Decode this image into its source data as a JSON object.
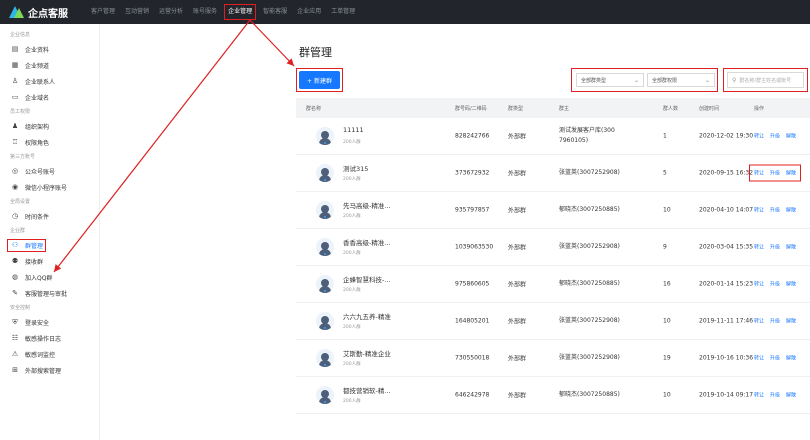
{
  "app": {
    "logo_text": "企点客服"
  },
  "topnav": [
    {
      "label": "客户管理",
      "active": false
    },
    {
      "label": "互动营销",
      "active": false
    },
    {
      "label": "运营分析",
      "active": false
    },
    {
      "label": "账号服务",
      "active": false
    },
    {
      "label": "企业管理",
      "active": true
    },
    {
      "label": "智能客服",
      "active": false
    },
    {
      "label": "企业应用",
      "active": false
    },
    {
      "label": "工单管理",
      "active": false
    }
  ],
  "sidebar": {
    "sections": [
      {
        "title": "企业信息",
        "items": [
          {
            "label": "企业资料",
            "icon": "document-icon"
          },
          {
            "label": "企业频道",
            "icon": "channel-icon"
          },
          {
            "label": "企业联系人",
            "icon": "contact-icon"
          },
          {
            "label": "企业域名",
            "icon": "domain-icon"
          }
        ]
      },
      {
        "title": "员工权限",
        "items": [
          {
            "label": "组织架构",
            "icon": "org-icon"
          },
          {
            "label": "权限角色",
            "icon": "role-icon"
          }
        ]
      },
      {
        "title": "第三方账号",
        "items": [
          {
            "label": "公众号账号",
            "icon": "official-account-icon"
          },
          {
            "label": "微信小程序账号",
            "icon": "mini-program-icon"
          }
        ]
      },
      {
        "title": "全局设置",
        "items": [
          {
            "label": "时间条件",
            "icon": "time-condition-icon"
          }
        ]
      },
      {
        "title": "企业群",
        "items": [
          {
            "label": "群管理",
            "icon": "group-manage-icon",
            "active": true
          },
          {
            "label": "接收群",
            "icon": "receive-group-icon"
          },
          {
            "label": "加入QQ群",
            "icon": "join-qq-group-icon"
          },
          {
            "label": "客服管理与审批",
            "icon": "approval-icon"
          }
        ]
      },
      {
        "title": "安全控制",
        "items": [
          {
            "label": "登录安全",
            "icon": "login-security-icon"
          },
          {
            "label": "敏感操作日志",
            "icon": "log-icon"
          },
          {
            "label": "敏感词监控",
            "icon": "warning-icon"
          },
          {
            "label": "外部搜索管理",
            "icon": "search-manage-icon"
          }
        ]
      }
    ]
  },
  "main": {
    "title": "群管理",
    "new_button": "+ 新建群",
    "filter_type": "全部群类型",
    "filter_scope": "全部群权限",
    "search_placeholder": "群名称/群主姓名或账号",
    "columns": [
      "群名称",
      "群号码/二维码",
      "群类型",
      "群主",
      "群人数",
      "创建时间",
      "操作"
    ],
    "rows": [
      {
        "name": "11111",
        "sub": "200人群",
        "id": "828242766",
        "type": "外部群",
        "owner": "测试发展客户库(300",
        "owner2": "7960105)",
        "count": "1",
        "time": "2020-12-02 19:30",
        "ops": [
          "转让",
          "升级",
          "解散"
        ],
        "highlight": false
      },
      {
        "name": "测试315",
        "sub": "200人群",
        "id": "373672932",
        "type": "外部群",
        "owner": "张蓝英(3007252908)",
        "owner2": "",
        "count": "5",
        "time": "2020-09-15 16:32",
        "ops": [
          "转让",
          "升级",
          "解散"
        ],
        "highlight": true
      },
      {
        "name": "先马高级-精准...",
        "sub": "200人群",
        "id": "935797857",
        "type": "外部群",
        "owner": "郁晓杰(3007250885)",
        "owner2": "",
        "count": "10",
        "time": "2020-04-10 14:07",
        "ops": [
          "转让",
          "升级",
          "解散"
        ],
        "highlight": false
      },
      {
        "name": "香香高级-精准...",
        "sub": "200人群",
        "id": "1039063530",
        "type": "外部群",
        "owner": "张蓝英(3007252908)",
        "owner2": "",
        "count": "9",
        "time": "2020-03-04 15:35",
        "ops": [
          "转让",
          "升级",
          "解散"
        ],
        "highlight": false
      },
      {
        "name": "企蜂智慧科技-...",
        "sub": "200人群",
        "id": "975860605",
        "type": "外部群",
        "owner": "郁晓杰(3007250885)",
        "owner2": "",
        "count": "16",
        "time": "2020-01-14 15:23",
        "ops": [
          "转让",
          "升级",
          "解散"
        ],
        "highlight": false
      },
      {
        "name": "六六九五养-精准",
        "sub": "200人群",
        "id": "164805201",
        "type": "外部群",
        "owner": "张蓝英(3007252908)",
        "owner2": "",
        "count": "10",
        "time": "2019-11-11 17:46",
        "ops": [
          "转让",
          "升级",
          "解散"
        ],
        "highlight": false
      },
      {
        "name": "艾斯勤-精准企业",
        "sub": "200人群",
        "id": "730550018",
        "type": "外部群",
        "owner": "张蓝英(3007252908)",
        "owner2": "",
        "count": "19",
        "time": "2019-10-16 10:36",
        "ops": [
          "转让",
          "升级",
          "解散"
        ],
        "highlight": false
      },
      {
        "name": "都技营销软-精...",
        "sub": "200人群",
        "id": "646242978",
        "type": "外部群",
        "owner": "郁晓杰(3007250885)",
        "owner2": "",
        "count": "10",
        "time": "2019-10-14 09:17",
        "ops": [
          "转让",
          "升级",
          "解散"
        ],
        "highlight": false
      }
    ]
  },
  "colors": {
    "topbar": "#22252b",
    "accent": "#1677ff",
    "annotation": "#e02020"
  }
}
